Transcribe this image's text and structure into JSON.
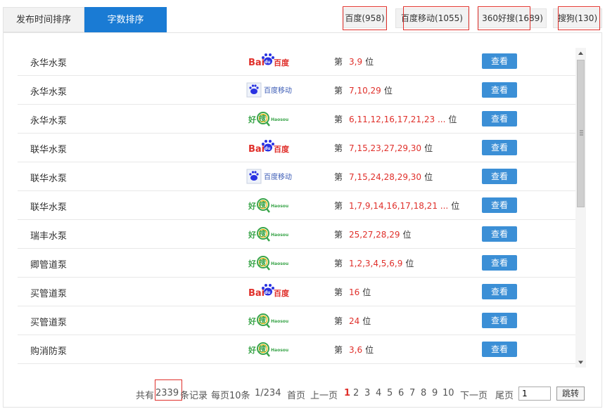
{
  "tabs": [
    {
      "label": "发布时间排序",
      "active": false
    },
    {
      "label": "字数排序",
      "active": true
    }
  ],
  "engines": [
    {
      "name": "百度",
      "count": "(958)"
    },
    {
      "name": "百度移动",
      "count": "(1055)"
    },
    {
      "name": "360好搜",
      "count": "(1689)"
    },
    {
      "name": "搜狗",
      "count": "(130)"
    }
  ],
  "rows": [
    {
      "keyword": "永华水泵",
      "engine": "baidu",
      "ranks": "3,9"
    },
    {
      "keyword": "永华水泵",
      "engine": "baidu-mobile",
      "ranks": "7,10,29"
    },
    {
      "keyword": "永华水泵",
      "engine": "haosou",
      "ranks": "6,11,12,16,17,21,23 ..."
    },
    {
      "keyword": "联华水泵",
      "engine": "baidu",
      "ranks": "7,15,23,27,29,30"
    },
    {
      "keyword": "联华水泵",
      "engine": "baidu-mobile",
      "ranks": "7,15,24,28,29,30"
    },
    {
      "keyword": "联华水泵",
      "engine": "haosou",
      "ranks": "1,7,9,14,16,17,18,21 ..."
    },
    {
      "keyword": "瑞丰水泵",
      "engine": "haosou",
      "ranks": "25,27,28,29"
    },
    {
      "keyword": "卿管道泵",
      "engine": "haosou",
      "ranks": "1,2,3,4,5,6,9"
    },
    {
      "keyword": "买管道泵",
      "engine": "baidu",
      "ranks": "16"
    },
    {
      "keyword": "买管道泵",
      "engine": "haosou",
      "ranks": "24"
    },
    {
      "keyword": "购消防泵",
      "engine": "haosou",
      "ranks": "3,6"
    }
  ],
  "row_labels": {
    "prefix": "第",
    "suffix": "位",
    "view": "查看"
  },
  "logos": {
    "baidu_text_left": "Bai",
    "baidu_paw": "du",
    "baidu_cn": "百度",
    "mobile_text": "百度移动",
    "haosou_hao": "好",
    "haosou_sou": "搜",
    "haosou_en": "Haosou"
  },
  "pager": {
    "total_pre": "共有",
    "total": "2339",
    "total_post": "条记录",
    "per_page": "每页10条",
    "page_of": "1/234",
    "first": "首页",
    "prev": "上一页",
    "current": "1",
    "pages": [
      "2",
      "3",
      "4",
      "5",
      "6",
      "7",
      "8",
      "9",
      "10"
    ],
    "next": "下一页",
    "last": "尾页",
    "jump_value": "1",
    "jump_label": "跳转"
  },
  "colors": {
    "accent": "#1a7bd4",
    "button": "#3b8fd6",
    "rank": "#e0302b",
    "highlight_box": "#e0302b"
  }
}
